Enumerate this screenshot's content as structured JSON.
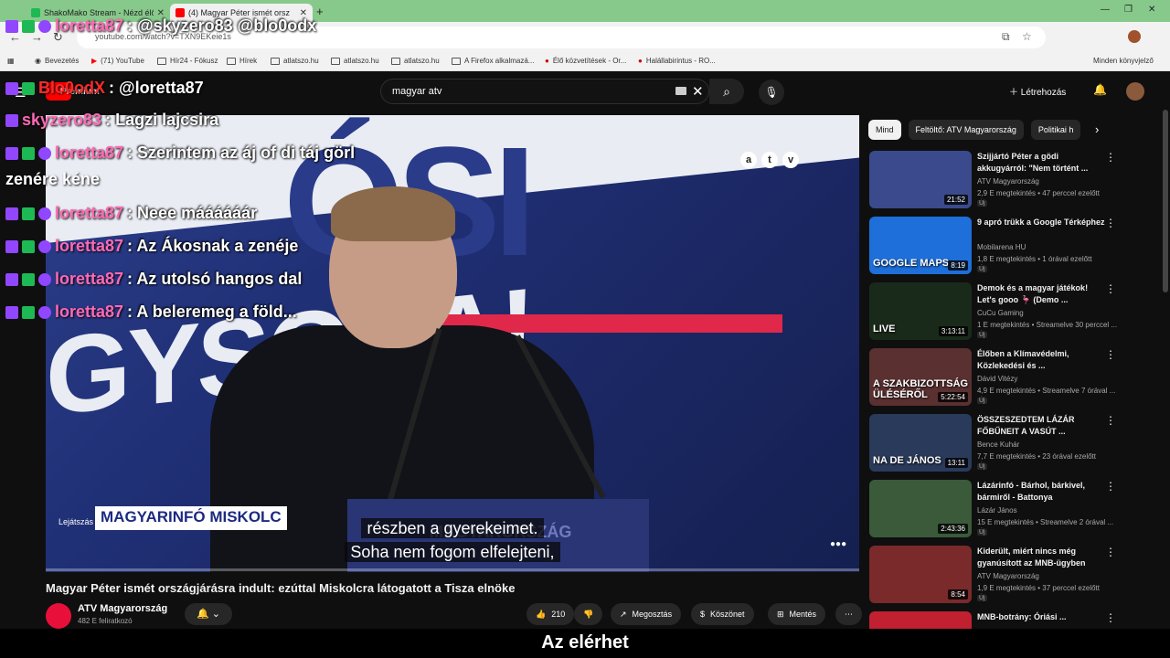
{
  "browser": {
    "tabs": [
      {
        "title": "ShakoMako Stream - Nézd élő",
        "active": false
      },
      {
        "title": "(4) Magyar Péter ismét orsz",
        "active": true
      }
    ],
    "url": "youtube.com/watch?v=TXN9EKeie1s",
    "bookmarks": [
      "Bevezetés",
      "(71) YouTube",
      "Hír24 - Fókusz",
      "Hírek",
      "atlatszo.hu",
      "atlatszo.hu",
      "atlatszo.hu",
      "A Firefox alkalmazá...",
      "Élő közvetítések - Or...",
      "Halállabirintus - RO...",
      "Minden könyvjelző"
    ]
  },
  "youtube_header": {
    "premium_label": "Premium",
    "search_value": "magyar atv",
    "create_label": "Létrehozás"
  },
  "chat": [
    {
      "badges": 3,
      "user": "loretta87",
      "user_color": "pink",
      "message": ": @skyzero83 @blo0odx"
    },
    {
      "badges": 2,
      "user": "Blo0odX",
      "user_color": "red",
      "message": ": @loretta87"
    },
    {
      "badges": 1,
      "user": "skyzero83",
      "user_color": "pink",
      "message": ": Lagzi lajcsira"
    },
    {
      "badges": 3,
      "user": "loretta87",
      "user_color": "pink",
      "message": ": Szerintem az áj of di táj görl"
    },
    {
      "badges": 3,
      "user": "loretta87",
      "user_color": "pink",
      "message": ": Neee máááááár"
    },
    {
      "badges": 3,
      "user": "loretta87",
      "user_color": "pink",
      "message": ": Az Ákosnak a zenéje"
    },
    {
      "badges": 3,
      "user": "loretta87",
      "user_color": "pink",
      "message": ": Az utolsó hangos dal"
    },
    {
      "badges": 3,
      "user": "loretta87",
      "user_color": "pink",
      "message": ": A beleremeg a föld..."
    }
  ],
  "chat_continuation": "zenére kéne",
  "video": {
    "channel_logo_letters": [
      "a",
      "t",
      "v"
    ],
    "banner_top": "ÓSI",
    "banner_bottom": "GYSOHA!",
    "lower_third_prefix": "Lejátszás",
    "lower_third": "MAGYARINFÓ MISKOLC",
    "podium_text": "MAGYARORSZÁG",
    "caption_line1": "részben a gyerekeimet.",
    "caption_line2": "Soha nem fogom elfelejteni,",
    "title": "Magyar Péter ismét országjárásra indult: ezúttal Miskolcra látogatott a Tisza elnöke",
    "channel": "ATV Magyarország",
    "subscribers": "482 E feliratkozó",
    "likes": "210",
    "share_label": "Megosztás",
    "thanks_label": "Köszönet",
    "save_label": "Mentés"
  },
  "bottom_subtitle": "Az elérhet",
  "sidebar": {
    "chips": [
      "Mind",
      "Feltöltő: ATV Magyarország",
      "Politikai h"
    ],
    "recommendations": [
      {
        "title": "Szijjártó Péter a gödi akkugyárról: \"Nem történt ...",
        "channel": "ATV Magyarország",
        "meta": "2,9 E megtekintés • 47 perccel ezelőtt",
        "badge": "Új",
        "duration": "21:52",
        "thumb_text": "",
        "thumb_color": "#3a4a8c"
      },
      {
        "title": "9 apró trükk a Google Térképhez",
        "channel": "Mobilarena HU",
        "meta": "1,8 E megtekintés • 1 órával ezelőtt",
        "badge": "Új",
        "duration": "8:19",
        "thumb_text": "GOOGLE MAPS",
        "thumb_color": "#1e6fd9"
      },
      {
        "title": "Demok és a magyar játékok! Let's gooo 🦩 (Demo ...",
        "channel": "CuCu Gaming",
        "meta": "1 E megtekintés • Streamelve 30 perccel ...",
        "badge": "Új",
        "duration": "3:13:11",
        "thumb_text": "LIVE",
        "thumb_color": "#1a2a1a"
      },
      {
        "title": "Élőben a Klímavédelmi, Közlekedési és ...",
        "channel": "Dávid Vitézy",
        "meta": "4,9 E megtekintés • Streamelve 7 órával ...",
        "badge": "Új",
        "duration": "5:22:54",
        "thumb_text": "A SZAKBIZOTTSÁG ÜLÉSÉRŐL",
        "thumb_color": "#5a3030"
      },
      {
        "title": "ÖSSZESZEDTEM LÁZÁR FŐBŰNEIT A VASÚT ...",
        "channel": "Bence Kuhár",
        "meta": "7,7 E megtekintés • 23 órával ezelőtt",
        "badge": "Új",
        "duration": "13:11",
        "thumb_text": "NA DE JÁNOS",
        "thumb_color": "#2a3a5a"
      },
      {
        "title": "Lázárinfó - Bárhol, bárkivel, bármiről - Battonya",
        "channel": "Lázár János",
        "meta": "15 E megtekintés • Streamelve 2 órával ...",
        "badge": "Új",
        "duration": "2:43:36",
        "thumb_text": "",
        "thumb_color": "#3a5a3a"
      },
      {
        "title": "Kiderült, miért nincs még gyanúsított az MNB-ügyben",
        "channel": "ATV Magyarország",
        "meta": "1,9 E megtekintés • 37 perccel ezelőtt",
        "badge": "Új",
        "duration": "8:54",
        "thumb_text": "",
        "thumb_color": "#7a2a2a"
      },
      {
        "title": "MNB-botrány: Óriási ...",
        "channel": "",
        "meta": "",
        "badge": "",
        "duration": "",
        "thumb_text": "",
        "thumb_color": "#c02030"
      }
    ]
  }
}
